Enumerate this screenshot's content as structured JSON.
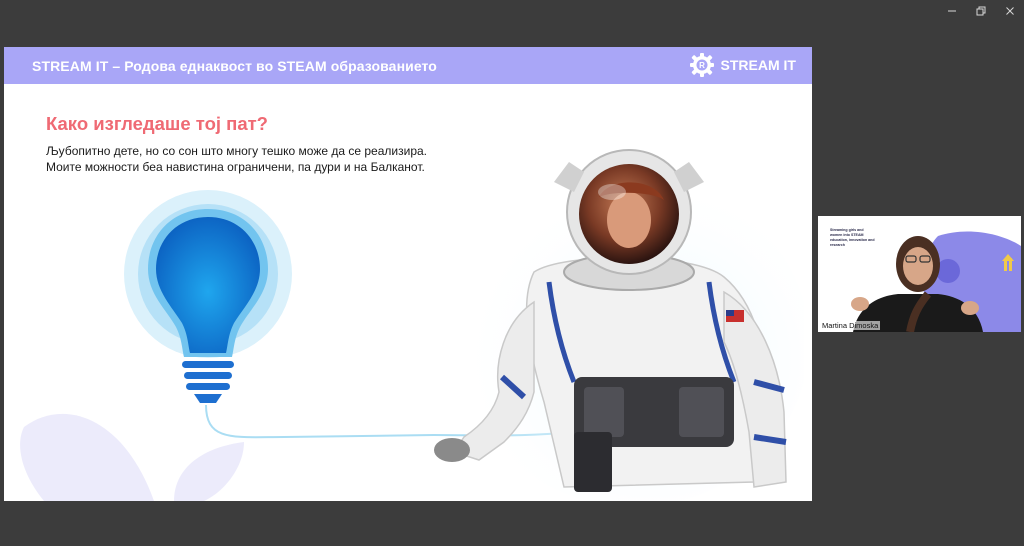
{
  "window": {
    "controls": [
      "minimize-icon",
      "restore-icon",
      "close-icon"
    ]
  },
  "slide": {
    "header_title": "STREAM IT – Родова еднаквост во STEAM образованието",
    "brand_name": "STREAM IT",
    "heading": "Како изгледаше тој пат?",
    "body_line1": "Љубопитно дете, но со сон што многу тешко може да се реализира.",
    "body_line2": "Моите можности беа навистина ограничени, па дури и на Балканот.",
    "colors": {
      "header": "#a9a6f7",
      "heading": "#ef6a74",
      "bulb": "#1f8ee0"
    },
    "icons": [
      "stream-it-logo-icon",
      "light-bulb-icon",
      "astronaut-image"
    ]
  },
  "webcam": {
    "participant_name": "Martina Dimoska",
    "background_text": "Streaming girls and women into STEAM education, innovation and research"
  }
}
